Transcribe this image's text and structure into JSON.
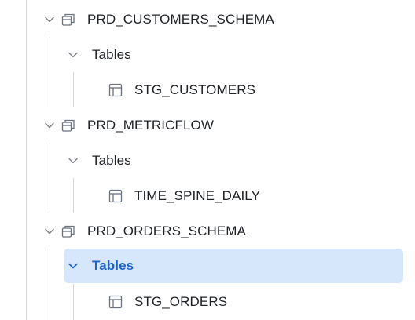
{
  "tree": {
    "schemas": [
      {
        "name": "PRD_CUSTOMERS_SCHEMA",
        "icon": "schema-icon",
        "folder": {
          "label": "Tables",
          "selected": false
        },
        "tables": [
          "STG_CUSTOMERS"
        ]
      },
      {
        "name": "PRD_METRICFLOW",
        "icon": "schema-icon",
        "folder": {
          "label": "Tables",
          "selected": false
        },
        "tables": [
          "TIME_SPINE_DAILY"
        ]
      },
      {
        "name": "PRD_ORDERS_SCHEMA",
        "icon": "schema-icon",
        "folder": {
          "label": "Tables",
          "selected": true
        },
        "tables": [
          "STG_ORDERS"
        ]
      }
    ]
  },
  "colors": {
    "selection_bg": "#d6e6fb",
    "selection_text": "#1a63c9",
    "guide_line": "#d4d7dc",
    "icon_gray": "#6b7280"
  }
}
